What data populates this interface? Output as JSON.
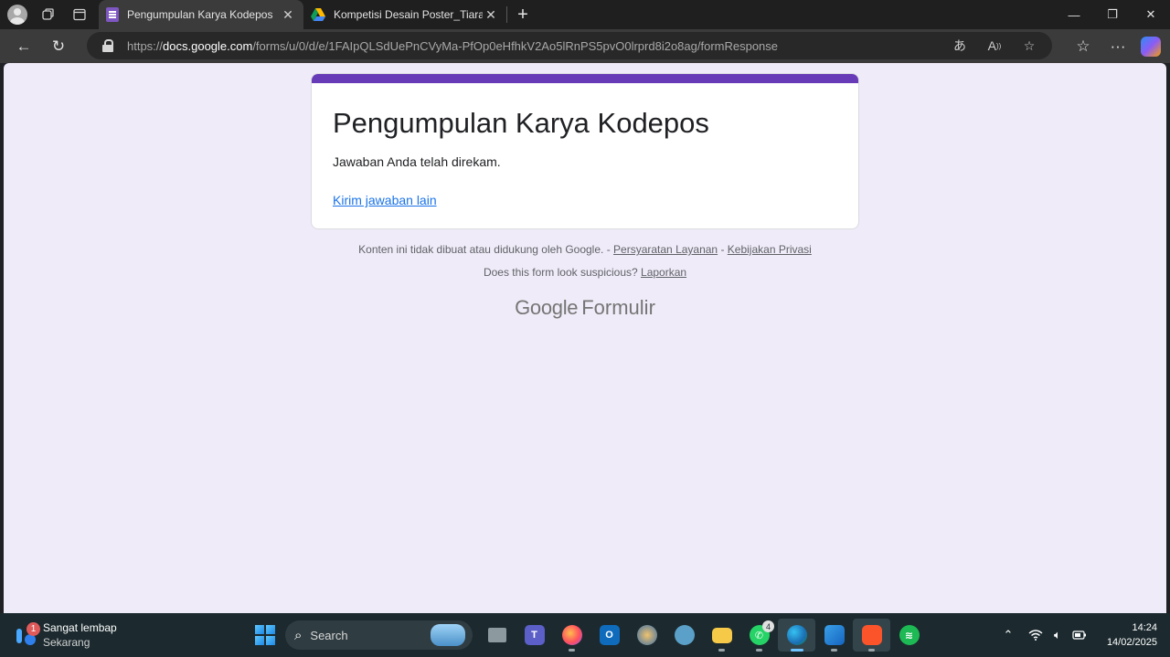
{
  "browser": {
    "tabs": [
      {
        "title": "Pengumpulan Karya Kodepos",
        "active": true,
        "favicon": "google-forms-icon"
      },
      {
        "title": "Kompetisi Desain Poster_Tiara Re",
        "active": false,
        "favicon": "google-drive-icon"
      }
    ],
    "url_scheme": "https://",
    "url_host": "docs.google.com",
    "url_path": "/forms/u/0/d/e/1FAIpQLSdUePnCVyMa-PfOp0eHfhkV2Ao5lRnPS5pvO0lrprd8i2o8ag/formResponse"
  },
  "form": {
    "title": "Pengumpulan Karya Kodepos",
    "confirmation": "Jawaban Anda telah direkam.",
    "submit_another": "Kirim jawaban lain",
    "accent_color": "#673ab7"
  },
  "footer": {
    "disclaimer": "Konten ini tidak dibuat atau didukung oleh Google. - ",
    "terms": "Persyaratan Layanan",
    "sep": " - ",
    "privacy": "Kebijakan Privasi",
    "suspicious": "Does this form look suspicious? ",
    "report": "Laporkan",
    "brand_google": "Google",
    "brand_product": "Formulir"
  },
  "taskbar": {
    "weather_title": "Sangat lembap",
    "weather_sub": "Sekarang",
    "weather_badge": "1",
    "search_placeholder": "Search",
    "whatsapp_badge": "4",
    "time": "14:24",
    "date": "14/02/2025"
  }
}
